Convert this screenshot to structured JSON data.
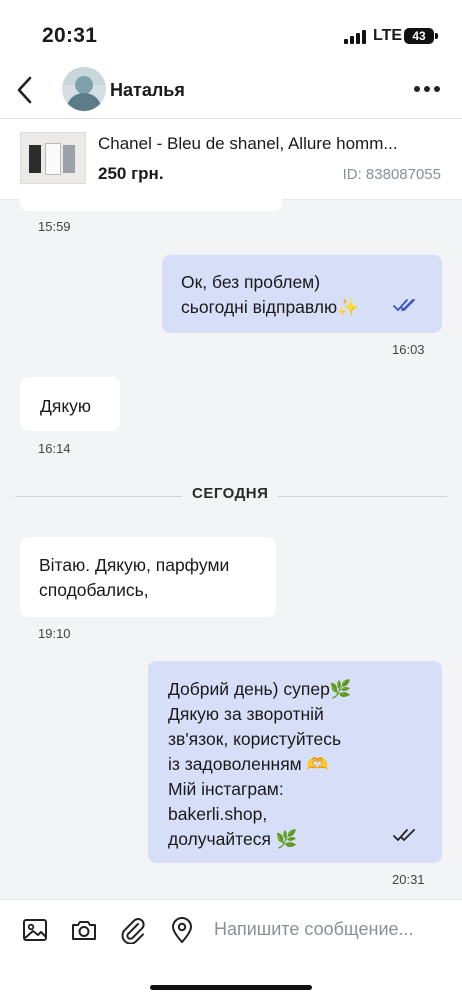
{
  "status_bar": {
    "time": "20:31",
    "network": "LTE",
    "battery": "43"
  },
  "header": {
    "contact_name": "Наталья"
  },
  "product": {
    "title": "Chanel - Bleu de shanel, Allure homm...",
    "price": "250 грн.",
    "id": "ID: 838087055"
  },
  "messages": [
    {
      "direction": "in",
      "lines": [],
      "time": "15:59"
    },
    {
      "direction": "out",
      "lines": [
        "Ок, без проблем)",
        "сьогодні відправлю✨"
      ],
      "time": "16:03"
    },
    {
      "direction": "in",
      "lines": [
        "Дякую"
      ],
      "time": "16:14"
    },
    {
      "direction": "in",
      "lines": [
        "Вітаю. Дякую, парфуми",
        "сподобались,"
      ],
      "time": "19:10"
    },
    {
      "direction": "out",
      "lines": [
        "Добрий день) супер🌿",
        "Дякую за зворотній",
        "зв'язок, користуйтесь",
        "із задоволенням 🫶",
        "Мій інстаграм:",
        "bakerli.shop,",
        "долучайтеся 🌿"
      ],
      "time": "20:31"
    }
  ],
  "date_divider": "СЕГОДНЯ",
  "composer": {
    "placeholder": "Напишите сообщение..."
  },
  "icons": [
    "back-arrow-icon",
    "more-dots-icon",
    "image-icon",
    "camera-icon",
    "paperclip-icon",
    "location-pin-icon",
    "double-check-icon"
  ],
  "colors": {
    "outgoing_bubble": "#d7def8",
    "incoming_bubble": "#ffffff",
    "read_ticks": "#3a55c4",
    "background": "#f2f4f5"
  }
}
